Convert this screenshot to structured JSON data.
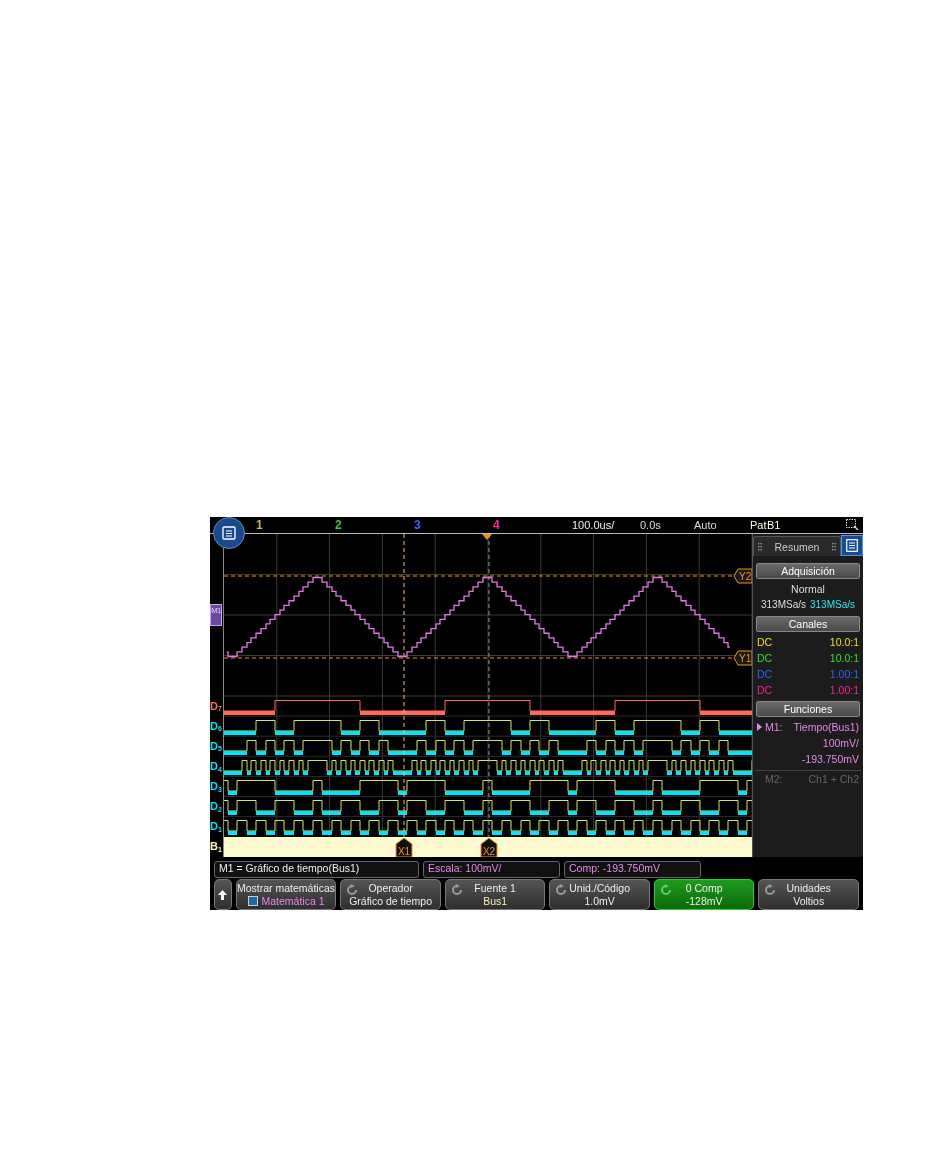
{
  "top_bar": {
    "channels": [
      {
        "label": "1",
        "color": "#c8c020"
      },
      {
        "label": "2",
        "color": "#30d030"
      },
      {
        "label": "3",
        "color": "#4060ff"
      },
      {
        "label": "4",
        "color": "#ff2090"
      }
    ],
    "timebase": "100.0us/",
    "delay": "0.0s",
    "trigger_mode": "Auto",
    "trigger_type": "Pat",
    "trigger_source": "B1"
  },
  "display": {
    "math_marker": "M1",
    "y_cursors": [
      {
        "label": "Y2"
      },
      {
        "label": "Y1"
      }
    ],
    "x_cursors": [
      {
        "label": "X1"
      },
      {
        "label": "X2"
      }
    ],
    "digital_channels": [
      {
        "label": "D$_{7}$",
        "color": "#ff6a5a"
      },
      {
        "label": "D$_{6}$",
        "color": "#00e5ff"
      },
      {
        "label": "D$_{5}$",
        "color": "#00e5ff"
      },
      {
        "label": "D$_{4}$",
        "color": "#00e5ff"
      },
      {
        "label": "D$_{3}$",
        "color": "#00e5ff"
      },
      {
        "label": "D$_{2}$",
        "color": "#00e5ff"
      },
      {
        "label": "D$_{1}$",
        "color": "#00e5ff"
      }
    ],
    "bus_label": "B$_{1}$"
  },
  "side_panel": {
    "tab": "Resumen",
    "acquisition": {
      "title": "Adquisición",
      "mode": "Normal",
      "rate": "313MSa/s",
      "rate_2": "313MSa/s"
    },
    "channels": {
      "title": "Canales",
      "rows": [
        {
          "coupling": "DC",
          "probe": "10.0:1",
          "color": "#e8e020"
        },
        {
          "coupling": "DC",
          "probe": "10.0:1",
          "color": "#30e030"
        },
        {
          "coupling": "DC",
          "probe": "1.00:1",
          "color": "#3060ff"
        },
        {
          "coupling": "DC",
          "probe": "1.00:1",
          "color": "#ff2090"
        }
      ]
    },
    "functions": {
      "title": "Funciones",
      "items": [
        {
          "name": "M1:",
          "expression": "Tiempo(Bus1)",
          "scale": "100mV/",
          "offset": "-193.750mV",
          "selected": true,
          "enabled": true
        },
        {
          "name": "M2:",
          "expression": "Ch1 + Ch2",
          "selected": false,
          "enabled": false
        }
      ]
    }
  },
  "info_line": {
    "function": "M1 = Gráfico de tiempo(Bus1)",
    "scale": "Escala: 100mV/",
    "offset": "Comp: -193.750mV"
  },
  "softkeys": [
    {
      "kind": "back",
      "selected": false
    },
    {
      "kind": "checkbox",
      "label": "Mostrar matemáticas",
      "value": "Matemática 1",
      "checked": true,
      "selected": false
    },
    {
      "kind": "knob",
      "label": "Operador",
      "value": "Gráfico de tiempo",
      "selected": false
    },
    {
      "kind": "knob",
      "label": "Fuente 1",
      "value": "Bus1",
      "selected": false
    },
    {
      "kind": "knob",
      "label": "Unid./Código",
      "value": "1.0mV",
      "selected": false
    },
    {
      "kind": "knob",
      "label": "0 Comp",
      "value": "-128mV",
      "selected": true
    },
    {
      "kind": "knob",
      "label": "Unidades",
      "value": "Voltios",
      "selected": false
    }
  ]
}
